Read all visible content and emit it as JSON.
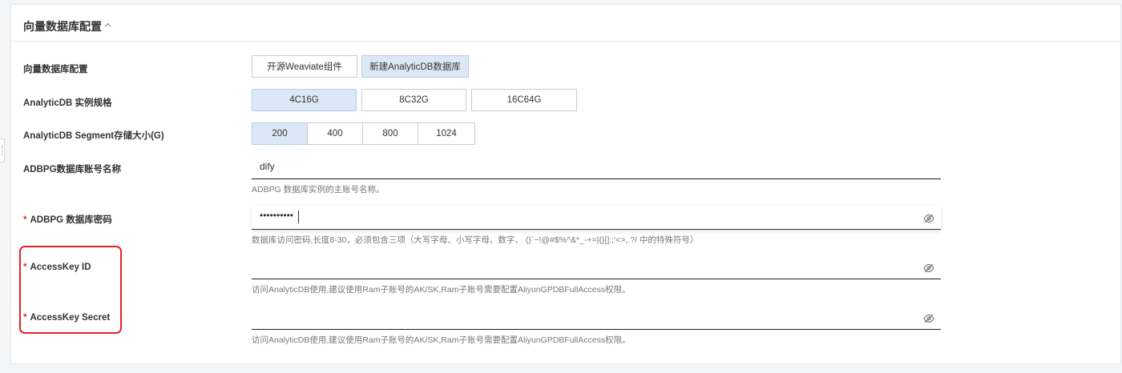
{
  "section": {
    "title": "向量数据库配置",
    "collapse_icon": "chevron-up-icon"
  },
  "vector_db": {
    "label": "向量数据库配置",
    "options": [
      "开源Weaviate组件",
      "新建AnalyticDB数据库"
    ],
    "selected": "新建AnalyticDB数据库"
  },
  "instance_spec": {
    "label": "AnalyticDB 实例规格",
    "options": [
      "4C16G",
      "8C32G",
      "16C64G"
    ],
    "selected": "4C16G"
  },
  "segment_storage": {
    "label": "AnalyticDB Segment存储大小(G)",
    "options": [
      "200",
      "400",
      "800",
      "1024"
    ],
    "selected": "200"
  },
  "account_name": {
    "label": "ADBPG数据库账号名称",
    "value": "dify",
    "help": "ADBPG 数据库实例的主账号名称。"
  },
  "db_password": {
    "required_mark": "*",
    "label": "ADBPG 数据库密码",
    "masked_value": "••••••••••",
    "toggle_icon": "eye-slash-icon",
    "help": "数据库访问密码,长度8-30，必须包含三项（大写字母、小写字母、数字、 ()`~!@#$%^&*_-+=|{}[]:;'<>,.?/ 中的特殊符号）"
  },
  "access_key_id": {
    "required_mark": "*",
    "label": "AccessKey ID",
    "value": "",
    "toggle_icon": "eye-slash-icon",
    "help": "访问AnalyticDB使用,建议使用Ram子账号的AK/SK,Ram子账号需要配置AliyunGPDBFullAccess权限。"
  },
  "access_key_secret": {
    "required_mark": "*",
    "label": "AccessKey Secret",
    "value": "",
    "toggle_icon": "eye-slash-icon",
    "help": "访问AnalyticDB使用,建议使用Ram子账号的AK/SK,Ram子账号需要配置AliyunGPDBFullAccess权限。"
  },
  "colors": {
    "selected_bg": "#dde8f6",
    "required": "#d93026",
    "highlight": "#e02424"
  }
}
